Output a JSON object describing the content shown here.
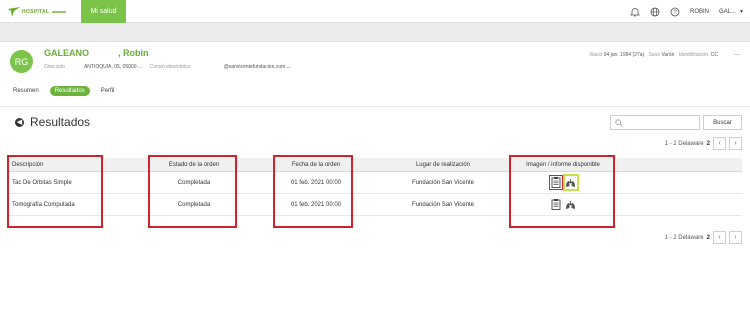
{
  "brand": {
    "logo_text": "HOSPITAL",
    "nav_label": "Mi salud"
  },
  "topbar": {
    "user_name": "ROBIN",
    "user_menu": "GAL..."
  },
  "patient": {
    "initials": "RG",
    "surname": "GALEANO",
    "given_name": ", Robin",
    "direccion_label": "Dirección",
    "direccion_value": "ANTIOQUIA, 05, 05000 ...",
    "correo_label": "Correo electrónico",
    "correo_value": "@sanvicentefundacion.com ...",
    "nacio_label": "Nació",
    "nacio_value": "04 jun. 1994 (27a)",
    "sexo_label": "Sexo",
    "sexo_value": "Varón",
    "id_label": "Identificación.",
    "id_value": "CC",
    "more": "..."
  },
  "tabs": [
    {
      "label": "Resumen",
      "active": false
    },
    {
      "label": "Resultados",
      "active": true
    },
    {
      "label": "Perfil",
      "active": false
    }
  ],
  "results": {
    "title": "Resultados",
    "search_placeholder": "",
    "search_button": "Buscar",
    "pager_text": "1 - 2 Delaware",
    "pager_total": "2",
    "columns": [
      "Descripción",
      "Estado de la orden",
      "Fecha de la orden",
      "Lugar de realización",
      "Imagen / informe disponible"
    ],
    "rows": [
      {
        "descripcion": "Tac De Orbitas Simple",
        "estado": "Completada",
        "fecha": "01 feb. 2021 00:00",
        "lugar": "Fundación San Vicente"
      },
      {
        "descripcion": "Tomografía Computada",
        "estado": "Completada",
        "fecha": "01 feb. 2021 00:00",
        "lugar": "Fundación San Vicente"
      }
    ]
  },
  "colors": {
    "brand_green": "#7cc34a",
    "highlight_red": "#d0232b",
    "highlight_yellow": "#c6e04a"
  }
}
